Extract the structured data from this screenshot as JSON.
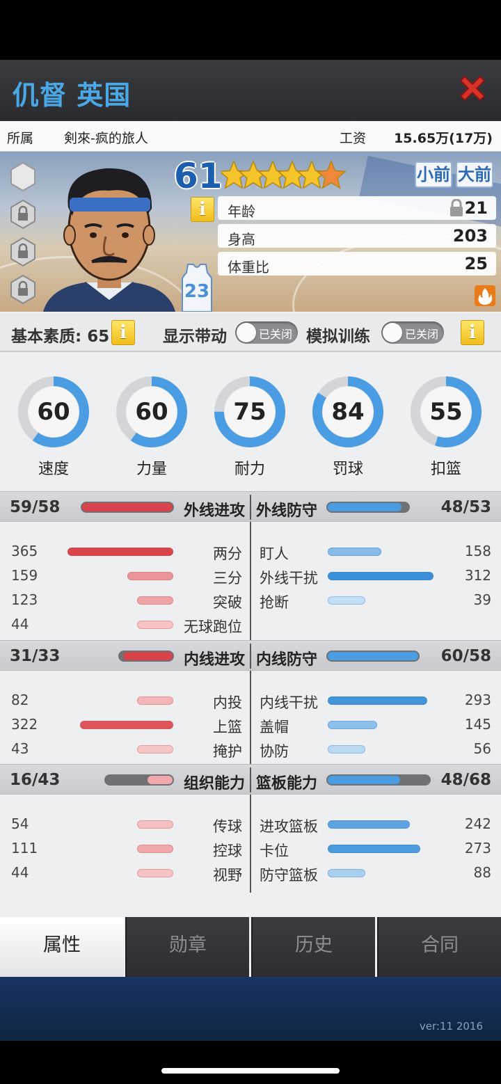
{
  "window": {
    "title": "仉督 英国"
  },
  "team": {
    "label": "所属",
    "name": "剣來-疯的旅人",
    "salary_label": "工资",
    "salary_value": "15.65万(17万)"
  },
  "player": {
    "overall": "61",
    "stars": 5.5,
    "positions": [
      "小前",
      "大前"
    ],
    "jersey_number": "23",
    "attributes": [
      {
        "label": "年龄",
        "value": "21",
        "locked": true
      },
      {
        "label": "身高",
        "value": "203"
      },
      {
        "label": "体重比",
        "value": "25"
      }
    ]
  },
  "toolbar": {
    "base_quality": "基本素质: 65",
    "show_boost_label": "显示带动",
    "show_boost_toggle": "已关闭",
    "sim_training_label": "模拟训练",
    "sim_training_toggle": "已关闭"
  },
  "rings": [
    {
      "label": "速度",
      "value": "60",
      "pct": 0.6
    },
    {
      "label": "力量",
      "value": "60",
      "pct": 0.6
    },
    {
      "label": "耐力",
      "value": "75",
      "pct": 0.75
    },
    {
      "label": "罚球",
      "value": "84",
      "pct": 0.84
    },
    {
      "label": "扣篮",
      "value": "55",
      "pct": 0.55
    }
  ],
  "sections": [
    {
      "left_title": "外线进攻",
      "left_value": "59/58",
      "left_pct": 1.0,
      "right_title": "外线防守",
      "right_value": "48/53",
      "right_pct": 0.91,
      "left_rows": [
        {
          "label": "两分",
          "value": "365"
        },
        {
          "label": "三分",
          "value": "159"
        },
        {
          "label": "突破",
          "value": "123"
        },
        {
          "label": "无球跑位",
          "value": "44"
        }
      ],
      "right_rows": [
        {
          "label": "盯人",
          "value": "158"
        },
        {
          "label": "外线干扰",
          "value": "312"
        },
        {
          "label": "抢断",
          "value": "39"
        }
      ]
    },
    {
      "left_title": "内线进攻",
      "left_value": "31/33",
      "left_pct": 0.94,
      "right_title": "内线防守",
      "right_value": "60/58",
      "right_pct": 1.0,
      "left_rows": [
        {
          "label": "内投",
          "value": "82"
        },
        {
          "label": "上篮",
          "value": "322"
        },
        {
          "label": "掩护",
          "value": "43"
        }
      ],
      "right_rows": [
        {
          "label": "内线干扰",
          "value": "293"
        },
        {
          "label": "盖帽",
          "value": "145"
        },
        {
          "label": "协防",
          "value": "56"
        }
      ]
    },
    {
      "left_title": "组织能力",
      "left_value": "16/43",
      "left_pct": 0.37,
      "right_title": "篮板能力",
      "right_value": "48/68",
      "right_pct": 0.71,
      "left_rows": [
        {
          "label": "传球",
          "value": "54"
        },
        {
          "label": "控球",
          "value": "111"
        },
        {
          "label": "视野",
          "value": "44"
        }
      ],
      "right_rows": [
        {
          "label": "进攻篮板",
          "value": "242"
        },
        {
          "label": "卡位",
          "value": "273"
        },
        {
          "label": "防守篮板",
          "value": "88"
        }
      ]
    }
  ],
  "tabs": [
    {
      "label": "属性",
      "active": true
    },
    {
      "label": "勋章",
      "active": false
    },
    {
      "label": "历史",
      "active": false
    },
    {
      "label": "合同",
      "active": false
    }
  ],
  "version": "ver:11  2016",
  "colors": {
    "accent_blue": "#4aa8e6",
    "bar_red": "#d9434a",
    "bar_blue": "#3a8fd8",
    "close_red": "#d8322b"
  }
}
